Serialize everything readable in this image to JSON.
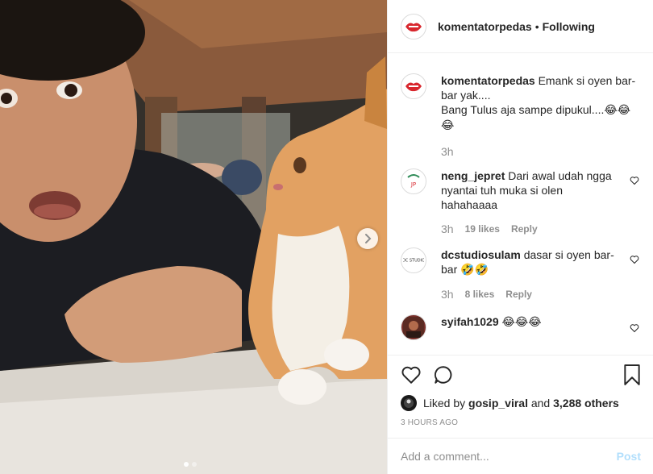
{
  "post": {
    "author": "komentatorpedas",
    "separator": "•",
    "follow_state": "Following"
  },
  "caption": {
    "username": "komentatorpedas",
    "text": "Emank si oyen bar-bar yak....",
    "text2": "Bang Tulus aja sampe dipukul....",
    "emoji": "😂😂😂",
    "time": "3h"
  },
  "comments": [
    {
      "username": "neng_jepret",
      "text": "Dari awal udah ngga nyantai tuh muka si olen hahahaaaa",
      "time": "3h",
      "likes": "19 likes",
      "reply": "Reply"
    },
    {
      "username": "dcstudiosulam",
      "text": "dasar si oyen bar-bar",
      "emoji": "🤣🤣",
      "time": "3h",
      "likes": "8 likes",
      "reply": "Reply"
    },
    {
      "username": "syifah1029",
      "emoji": "😂😂😂"
    }
  ],
  "liked_by": {
    "prefix": "Liked by",
    "user": "gosip_viral",
    "middle": "and",
    "others": "3,288 others"
  },
  "timestamp": "3 HOURS AGO",
  "add_comment": {
    "placeholder": "Add a comment...",
    "post_label": "Post"
  },
  "colors": {
    "accent": "#3897f0",
    "post_disabled": "#b2dffc",
    "text_secondary": "#8e8e8e"
  },
  "icons": [
    "heart-icon",
    "comment-icon",
    "bookmark-icon",
    "chevron-right-icon",
    "like-heart-icon"
  ]
}
